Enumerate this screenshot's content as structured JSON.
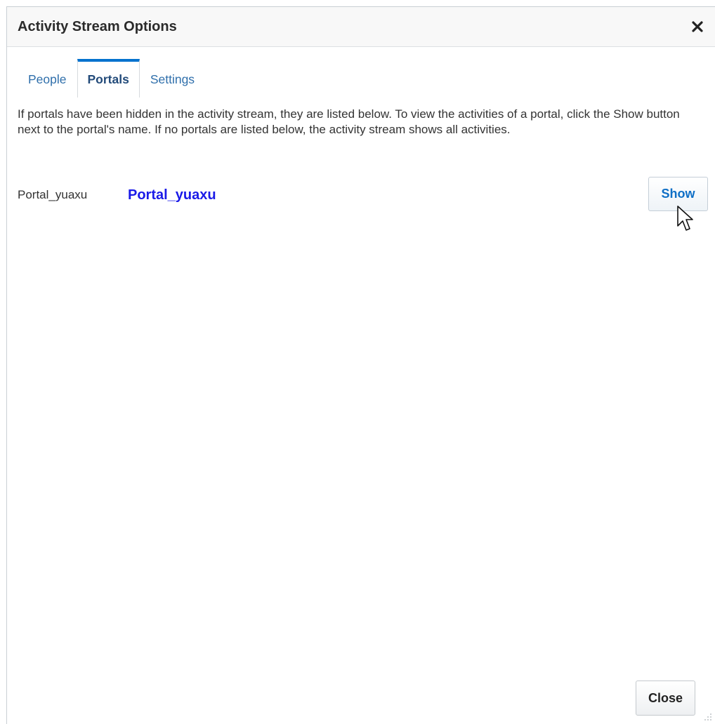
{
  "dialog": {
    "title": "Activity Stream Options",
    "close_icon": "close-icon"
  },
  "tabs": [
    {
      "label": "People",
      "active": false
    },
    {
      "label": "Portals",
      "active": true
    },
    {
      "label": "Settings",
      "active": false
    }
  ],
  "portals_tab": {
    "description": "If portals have been hidden in the activity stream, they are listed below. To view the activities of a portal, click the Show button next to the portal's name. If no portals are listed below, the activity stream shows all activities.",
    "hidden_portals": [
      {
        "name": "Portal_yuaxu",
        "link_label": "Portal_yuaxu",
        "action_label": "Show"
      }
    ]
  },
  "footer": {
    "close_label": "Close"
  },
  "colors": {
    "accent": "#0572ce",
    "tab_link": "#2f6fab",
    "portal_link": "#1a1ae8",
    "button_text": "#0f6fc6"
  },
  "icons": {
    "close": "close-icon",
    "cursor": "mouse-pointer-icon",
    "resize": "resize-grip-icon"
  }
}
